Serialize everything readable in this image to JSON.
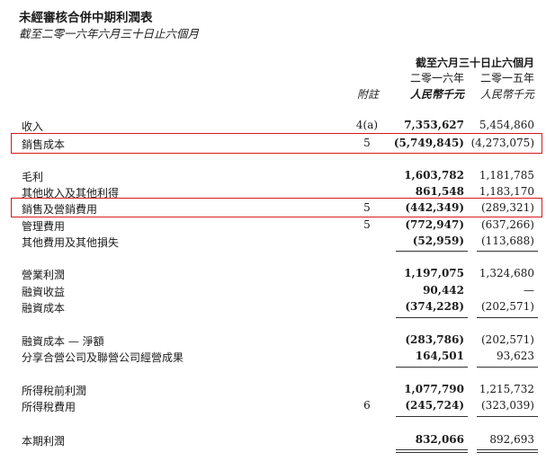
{
  "title": "未經審核合併中期利潤表",
  "subtitle": "截至二零一六年六月三十日止六個月",
  "header": {
    "period": "截至六月三十日止六個月",
    "year_2016": "二零一六年",
    "year_2015": "二零一五年",
    "note_col": "附註",
    "unit_2016": "人民幣千元",
    "unit_2015": "人民幣千元"
  },
  "rows": [
    {
      "label": "收入",
      "note": "4(a)",
      "v2016": "7,353,627",
      "v2015": "5,454,860"
    },
    {
      "label": "銷售成本",
      "note": "5",
      "v2016": "(5,749,845)",
      "v2015": "(4,273,075)"
    },
    {
      "label": "毛利",
      "note": "",
      "v2016": "1,603,782",
      "v2015": "1,181,785"
    },
    {
      "label": "其他收入及其他利得",
      "note": "",
      "v2016": "861,548",
      "v2015": "1,183,170"
    },
    {
      "label": "銷售及營銷費用",
      "note": "5",
      "v2016": "(442,349)",
      "v2015": "(289,321)"
    },
    {
      "label": "管理費用",
      "note": "5",
      "v2016": "(772,947)",
      "v2015": "(637,266)"
    },
    {
      "label": "其他費用及其他損失",
      "note": "",
      "v2016": "(52,959)",
      "v2015": "(113,688)"
    },
    {
      "label": "營業利潤",
      "note": "",
      "v2016": "1,197,075",
      "v2015": "1,324,680"
    },
    {
      "label": "融資收益",
      "note": "",
      "v2016": "90,442",
      "v2015": "—"
    },
    {
      "label": "融資成本",
      "note": "",
      "v2016": "(374,228)",
      "v2015": "(202,571)"
    },
    {
      "label": "融資成本 — 淨額",
      "note": "",
      "v2016": "(283,786)",
      "v2015": "(202,571)"
    },
    {
      "label": "分享合營公司及聯營公司經營成果",
      "note": "",
      "v2016": "164,501",
      "v2015": "93,623"
    },
    {
      "label": "所得稅前利潤",
      "note": "",
      "v2016": "1,077,790",
      "v2015": "1,215,732"
    },
    {
      "label": "所得稅費用",
      "note": "6",
      "v2016": "(245,724)",
      "v2015": "(323,039)"
    },
    {
      "label": "本期利潤",
      "note": "",
      "v2016": "832,066",
      "v2015": "892,693"
    }
  ],
  "highlight_color": "#d7191c"
}
